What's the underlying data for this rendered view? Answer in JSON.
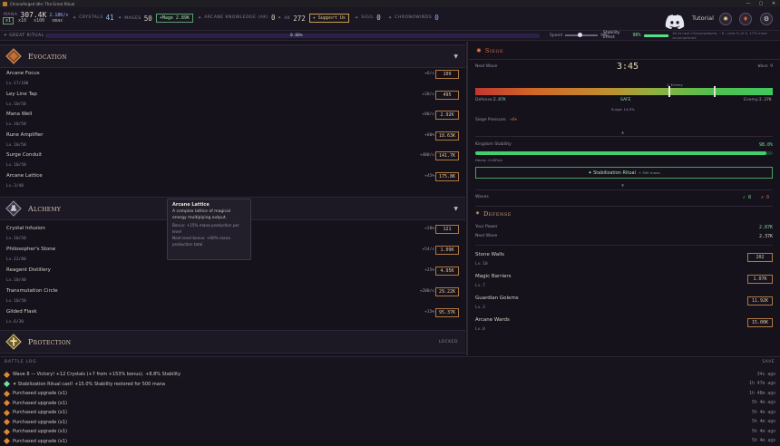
{
  "window": {
    "title": "Chronoforged Idle: The Great Ritual",
    "controls": [
      "—",
      "▢",
      "✕"
    ]
  },
  "top": {
    "mana_label": "MANA",
    "mana": "307.4K",
    "mana_rate": "2.18K/s",
    "multipliers": [
      "x1",
      "x10",
      "x100",
      "xmax"
    ],
    "crystals_label": "CRYSTALS",
    "crystals": "41",
    "mages_label": "MAGES",
    "mages": "50",
    "hire_mage": "+Mage 2.89K",
    "arcane_label": "ARCANE KNOWLEDGE (AK)",
    "arcane": "0",
    "ak_label": "AK",
    "ak": "272",
    "support": "✦ Support Us",
    "sigil_label": "SIGIL",
    "sigil": "0",
    "chrono_label": "CHRONOWINDS",
    "chrono": "0",
    "tutorial": "Tutorial"
  },
  "ritual": {
    "label": "✦ GREAT RITUAL",
    "percent": "0.00%",
    "speed_label": "Speed",
    "speed_pct": "9%",
    "stability_label": "Stability Effect",
    "stability_pct": "96%",
    "stability_fraction": 0.96,
    "stability_note": "All at next Chronoweaved, ~8 - next % of X, 17% more accomplished"
  },
  "evocation": {
    "title": "Evocation",
    "items": [
      {
        "name": "Arcane Focus",
        "level": "Lv.17/100",
        "rate": "+6/s",
        "cost": "109"
      },
      {
        "name": "Ley Line Tap",
        "level": "Lv.10/50",
        "rate": "+20/s",
        "cost": "495"
      },
      {
        "name": "Mana Well",
        "level": "Lv.10/50",
        "rate": "+80/s",
        "cost": "2.92K"
      },
      {
        "name": "Rune Amplifier",
        "level": "Lv.10/50",
        "rate": "+80%",
        "cost": "18.63K"
      },
      {
        "name": "Surge Conduit",
        "level": "Lv.10/50",
        "rate": "+400/s",
        "cost": "141.7K"
      },
      {
        "name": "Arcane Lattice",
        "level": "Lv.3/40",
        "rate": "+45%",
        "cost": "175.8K"
      }
    ]
  },
  "alchemy": {
    "title": "Alchemy",
    "items": [
      {
        "name": "Crystal Infusion",
        "level": "Lv.10/50",
        "rate": "+20%",
        "cost": "121"
      },
      {
        "name": "Philosopher's Stone",
        "level": "Lv.12/80",
        "rate": "+54/s",
        "cost": "1.09K"
      },
      {
        "name": "Reagent Distillery",
        "level": "Lv.10/40",
        "rate": "+25%",
        "cost": "4.95K"
      },
      {
        "name": "Transmutation Circle",
        "level": "Lv.10/50",
        "rate": "+200/s",
        "cost": "29.22K"
      },
      {
        "name": "Gilded Flask",
        "level": "Lv.6/30",
        "rate": "+15%",
        "cost": "95.37K"
      }
    ]
  },
  "protection": {
    "title": "Protection",
    "locked": "LOCKED"
  },
  "tooltip": {
    "title": "Arcane Lattice",
    "desc": "A complex lattice of magical energy multiplying output.",
    "bonus": "Bonus: +15% mana production per level",
    "next": "Next level bonus: +60% mana production total"
  },
  "siege": {
    "title": "Siege",
    "next_wave_label": "Next Wave",
    "timer": "3:45",
    "wave": "Wave 9",
    "enemy_marker": "⚠ Enemy",
    "safe": "SAFE",
    "defense_label": "Defense:",
    "defense_val": "2.87K",
    "enemy_label": "Enemy:",
    "enemy_val": "2.37K",
    "surge": "Surge: 14.0%",
    "pressure_label": "Siege Pressure:",
    "pressure_val": "+6%",
    "kstab_label": "Kingdom Stability",
    "kstab_val": "98.0%",
    "kstab_fraction": 0.98,
    "decay": "Decay -0.06%/s",
    "ritual_btn": "✦ Stabilization Ritual",
    "ritual_cost": "+ 50K mana",
    "waves_label": "Waves",
    "waves_won": "✓ 8",
    "waves_lost": "✗ 0"
  },
  "defense": {
    "title": "Defense",
    "power_label": "Your Power",
    "power_val": "2.87K",
    "next_label": "Next Wave",
    "next_val": "2.37K",
    "items": [
      {
        "name": "Stone Walls",
        "level": "Lv.10",
        "cost": "202"
      },
      {
        "name": "Magic Barriers",
        "level": "Lv.7",
        "cost": "1.07K"
      },
      {
        "name": "Guardian Golems",
        "level": "Lv.3",
        "cost": "11.92K"
      },
      {
        "name": "Arcane Wards",
        "level": "Lv.0",
        "cost": "15.00K"
      }
    ]
  },
  "log": {
    "title": "BATTLE LOG",
    "save": "SAVE",
    "entries": [
      {
        "text": "Wave 8 — Victory! +12 Crystals (+7 from +153% bonus). +8.8% Stability",
        "time": "34s ago",
        "kind": "wave"
      },
      {
        "text": "✦ Stabilization Ritual cast! +15.0% Stability restored for 500 mana",
        "time": "1h 47m ago",
        "kind": "star"
      },
      {
        "text": "Purchased upgrade (x1)",
        "time": "1h 48m ago",
        "kind": "buy"
      },
      {
        "text": "Purchased upgrade (x1)",
        "time": "5h 4m ago",
        "kind": "buy"
      },
      {
        "text": "Purchased upgrade (x1)",
        "time": "5h 4m ago",
        "kind": "buy"
      },
      {
        "text": "Purchased upgrade (x1)",
        "time": "5h 4m ago",
        "kind": "buy"
      },
      {
        "text": "Purchased upgrade (x1)",
        "time": "5h 4m ago",
        "kind": "buy"
      },
      {
        "text": "Purchased upgrade (x1)",
        "time": "5h 4m ago",
        "kind": "buy"
      }
    ]
  }
}
